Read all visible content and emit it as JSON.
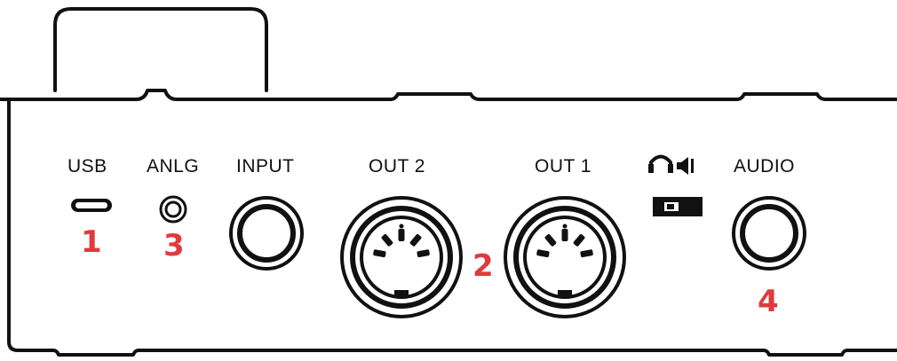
{
  "diagram": {
    "ports": {
      "usb": "USB",
      "anlg": "ANLG",
      "input": "INPUT",
      "out2": "OUT 2",
      "out1": "OUT 1",
      "audio": "AUDIO"
    },
    "callouts": {
      "usb": "1",
      "out": "2",
      "anlg": "3",
      "audio": "4"
    },
    "switch_icons": [
      "headphones-icon",
      "speaker-icon"
    ],
    "colors": {
      "callout": "#e03a3e",
      "ink": "#111111"
    }
  }
}
